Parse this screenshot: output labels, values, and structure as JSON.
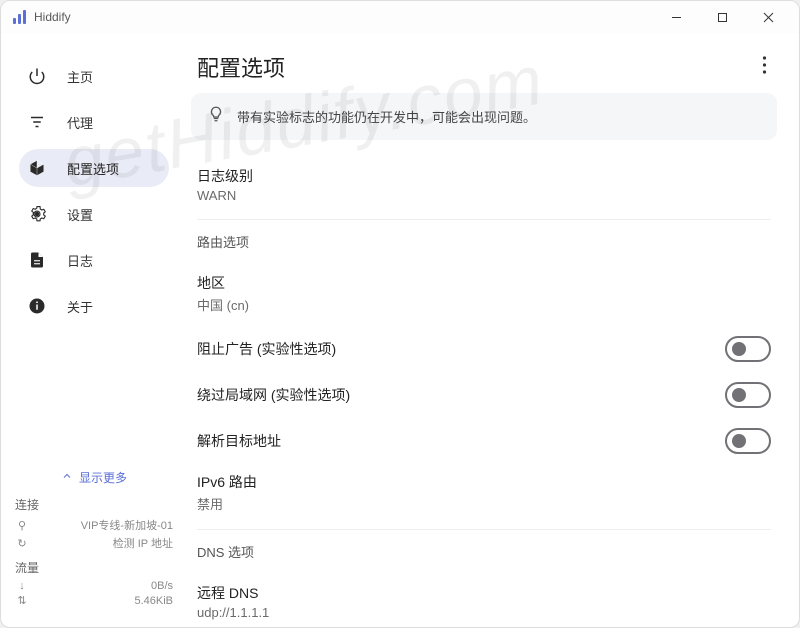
{
  "app": {
    "title": "Hiddify"
  },
  "watermark": "getHiddify.com",
  "nav": {
    "home": "主页",
    "proxy": "代理",
    "config": "配置选项",
    "settings": "设置",
    "logs": "日志",
    "about": "关于"
  },
  "sidebar_bottom": {
    "show_more": "显示更多",
    "connection_label": "连接",
    "connection_line": "VIP专线-新加坡-01",
    "ip_check": "检测 IP 地址",
    "traffic_label": "流量",
    "down_speed": "0B/s",
    "total": "5.46KiB"
  },
  "page": {
    "title": "配置选项",
    "banner": "带有实验标志的功能仍在开发中，可能会出现问题。",
    "log_level": {
      "label": "日志级别",
      "value": "WARN"
    },
    "route_section": "路由选项",
    "region": {
      "label": "地区",
      "value": "中国 (cn)"
    },
    "block_ads": "阻止广告 (实验性选项)",
    "bypass_lan": "绕过局域网 (实验性选项)",
    "resolve_dest": "解析目标地址",
    "ipv6_route": {
      "label": "IPv6 路由",
      "value": "禁用"
    },
    "dns_section": "DNS 选项",
    "remote_dns": {
      "label": "远程 DNS",
      "value": "udp://1.1.1.1"
    }
  }
}
